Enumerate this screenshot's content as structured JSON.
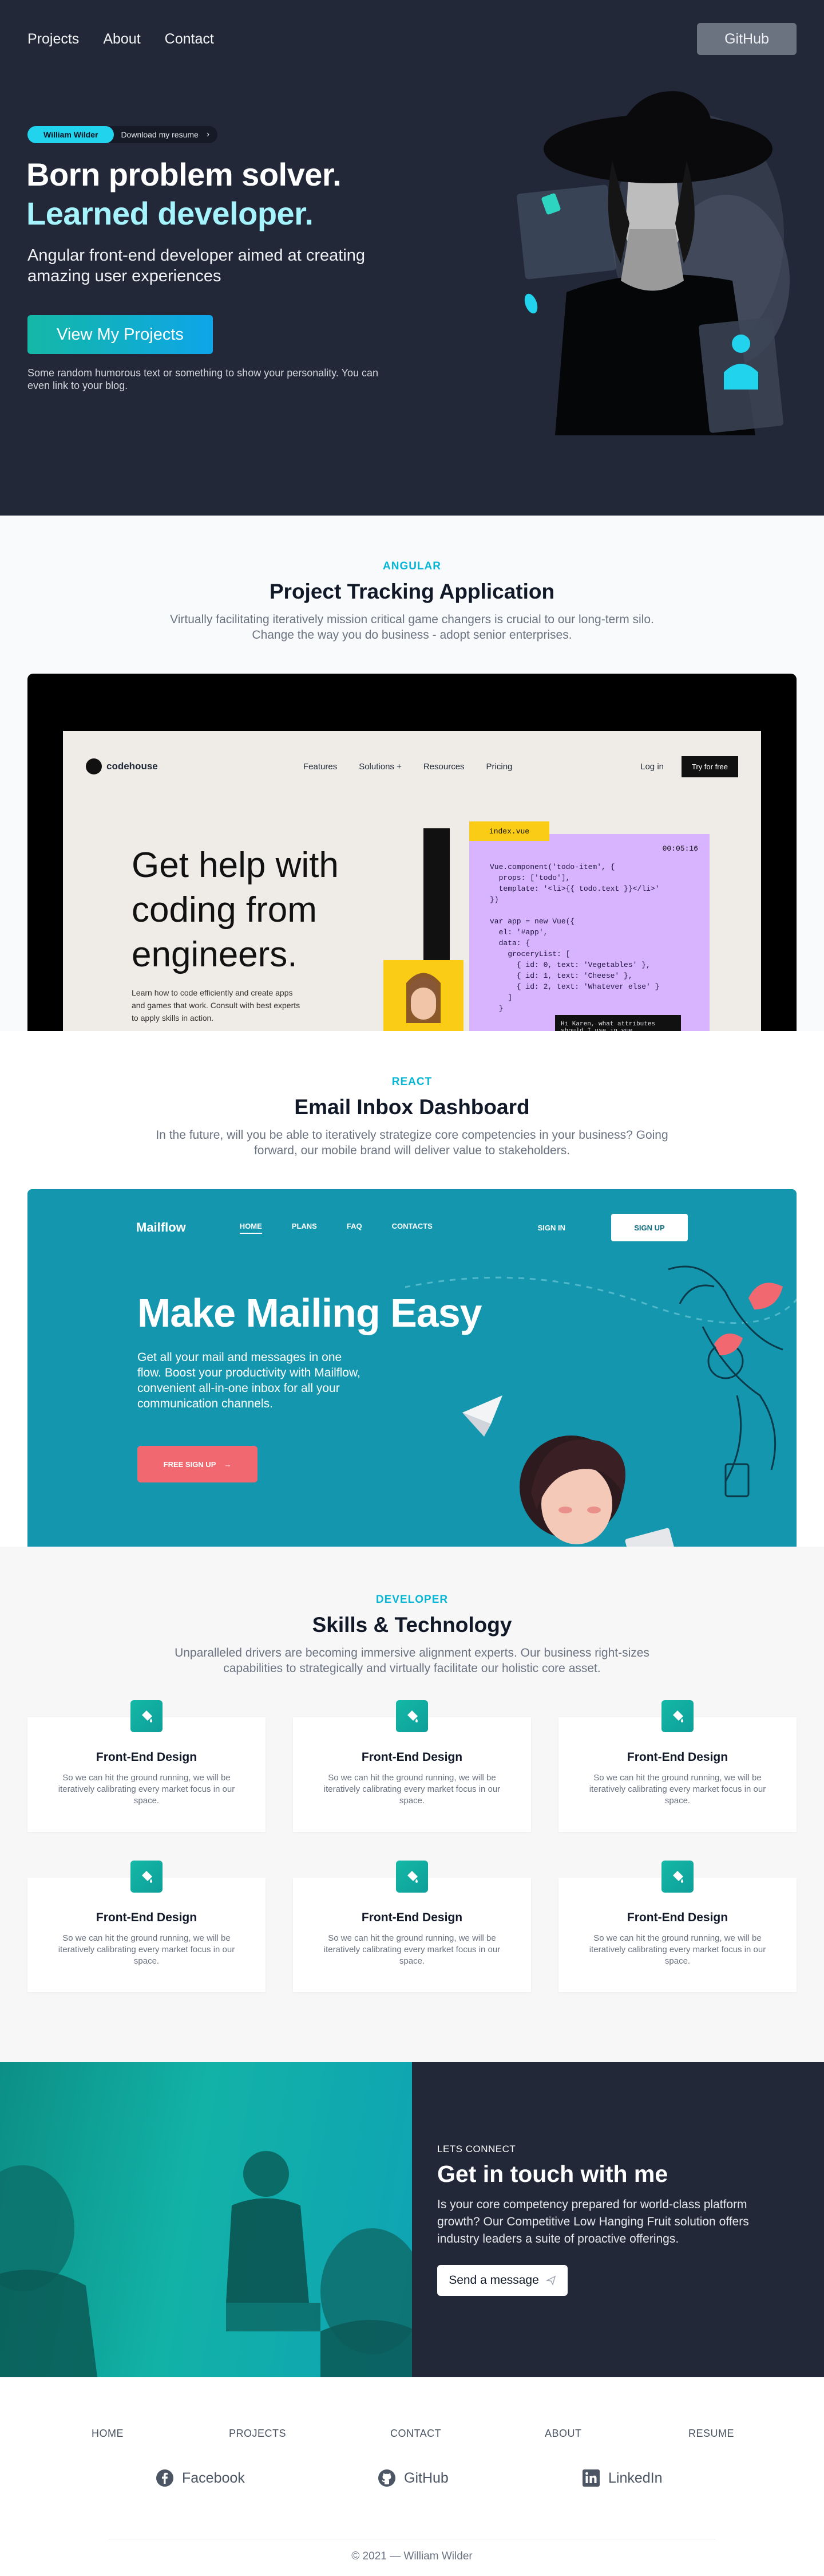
{
  "nav": {
    "links": [
      "Projects",
      "About",
      "Contact"
    ],
    "github": "GitHub"
  },
  "hero": {
    "tag": "William Wilder",
    "tag_text": "Download my resume",
    "title_line1": "Born problem solver.",
    "title_line2": "Learned developer.",
    "subtitle": "Angular front-end developer aimed at creating amazing user experiences",
    "cta": "View My Projects",
    "note": "Some random humorous text or something to show your personality. You can even link to your blog."
  },
  "project1": {
    "eyebrow": "ANGULAR",
    "title": "Project Tracking Application",
    "description": "Virtually facilitating iteratively mission critical game changers is crucial to our long-term silo. Change the way you do business - adopt senior enterprises.",
    "screen": {
      "logo": "codehouse",
      "links": [
        "Features",
        "Solutions +",
        "Resources",
        "Pricing"
      ],
      "login": "Log in",
      "try": "Try for free",
      "headline": "Get help with coding from engineers.",
      "small": "Learn how to code efficiently and create apps and games that work. Consult with best experts to apply skills in action.",
      "code_tab": "index.vue",
      "code_time": "00:05:16",
      "code": "Vue.component('todo-item', {\n  props: ['todo'],\n  template: '<li>{{ todo.text }}</li>'\n})\n\nvar app = new Vue({\n  el: '#app',\n  data: {\n    groceryList: [\n      { id: 0, text: 'Vegetables' },\n      { id: 1, text: 'Cheese' },\n      { id: 2, text: 'Whatever else' }\n    ]\n  }",
      "chat": "Hi Karen, what attributes should I use in vue"
    }
  },
  "project2": {
    "eyebrow": "REACT",
    "title": "Email Inbox Dashboard",
    "description": "In the future, will you be able to iteratively strategize core competencies in your business? Going forward, our mobile brand will deliver value to stakeholders.",
    "screen": {
      "logo": "Mailflow",
      "links": [
        "HOME",
        "PLANS",
        "FAQ",
        "CONTACTS"
      ],
      "signin": "SIGN IN",
      "signup": "SIGN UP",
      "headline": "Make Mailing Easy",
      "sub": "Get all your mail and messages in one flow. Boost your productivity with Mailflow, convenient all-in-one inbox for all your communication channels.",
      "cta": "FREE SIGN UP"
    }
  },
  "skills": {
    "eyebrow": "DEVELOPER",
    "title": "Skills & Technology",
    "description": "Unparalleled drivers are becoming immersive alignment experts. Our business right-sizes capabilities to strategically and virtually facilitate our holistic core asset.",
    "cards": [
      {
        "title": "Front-End Design",
        "text": "So we can hit the ground running, we will be iteratively calibrating every market focus in our space."
      },
      {
        "title": "Front-End Design",
        "text": "So we can hit the ground running, we will be iteratively calibrating every market focus in our space."
      },
      {
        "title": "Front-End Design",
        "text": "So we can hit the ground running, we will be iteratively calibrating every market focus in our space."
      },
      {
        "title": "Front-End Design",
        "text": "So we can hit the ground running, we will be iteratively calibrating every market focus in our space."
      },
      {
        "title": "Front-End Design",
        "text": "So we can hit the ground running, we will be iteratively calibrating every market focus in our space."
      },
      {
        "title": "Front-End Design",
        "text": "So we can hit the ground running, we will be iteratively calibrating every market focus in our space."
      }
    ]
  },
  "contact": {
    "eyebrow": "LETS CONNECT",
    "title": "Get in touch with me",
    "description": "Is your core competency prepared for world-class platform growth? Our Competitive Low Hanging Fruit solution offers industry leaders a suite of proactive offerings.",
    "button": "Send a message"
  },
  "footer": {
    "links": [
      "HOME",
      "PROJECTS",
      "CONTACT",
      "ABOUT",
      "RESUME"
    ],
    "social": [
      "Facebook",
      "GitHub",
      "LinkedIn"
    ],
    "copyright": "© 2021 — William Wilder"
  },
  "colors": {
    "navy": "#222838",
    "accent": "#22d3ee",
    "teal": "#14b8a6",
    "mailflow": "#1496ae",
    "coral": "#f16870"
  }
}
